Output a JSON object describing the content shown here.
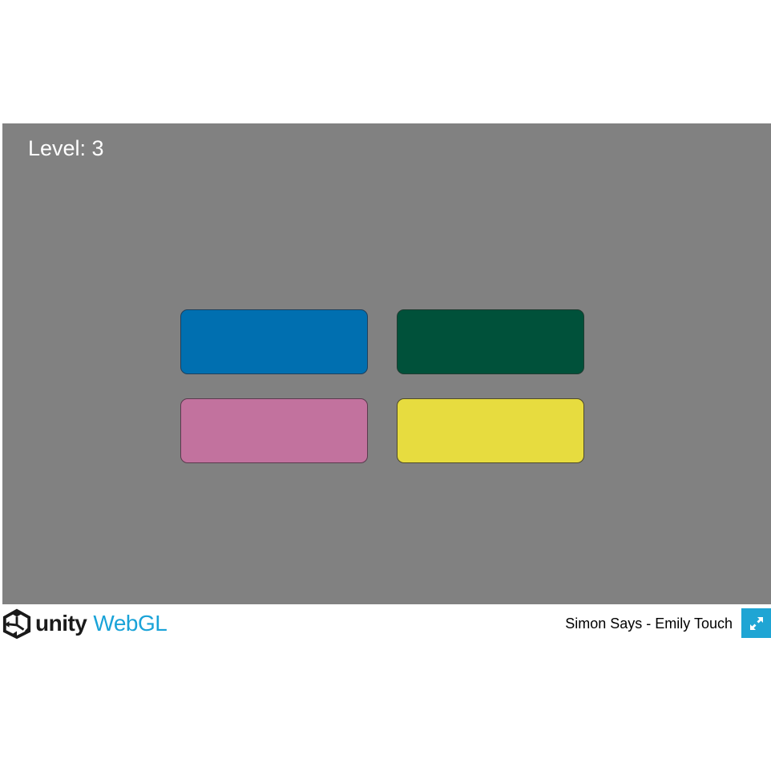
{
  "game": {
    "level_label": "Level: 3"
  },
  "buttons": [
    {
      "name": "blue",
      "color": "#006fb0"
    },
    {
      "name": "green",
      "color": "#00513a"
    },
    {
      "name": "pink",
      "color": "#c2729e"
    },
    {
      "name": "yellow",
      "color": "#e7dc3f"
    }
  ],
  "footer": {
    "logo_brand": "unity",
    "logo_product": "WebGL",
    "title": "Simon Says - Emily Touch",
    "fullscreen_icon": "fullscreen-icon",
    "accent_color": "#1fa5d4"
  },
  "colors": {
    "canvas_background": "#818181",
    "page_background": "#ffffff"
  }
}
